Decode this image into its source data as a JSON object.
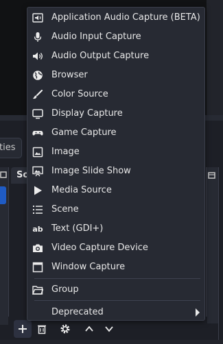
{
  "properties_button": {
    "label": "ties"
  },
  "sources_dock": {
    "title": "Sou"
  },
  "menu": {
    "items": [
      {
        "label": "Application Audio Capture (BETA)",
        "icon": "app-audio-icon"
      },
      {
        "label": "Audio Input Capture",
        "icon": "microphone-icon"
      },
      {
        "label": "Audio Output Capture",
        "icon": "speaker-icon"
      },
      {
        "label": "Browser",
        "icon": "globe-icon"
      },
      {
        "label": "Color Source",
        "icon": "paintbrush-icon"
      },
      {
        "label": "Display Capture",
        "icon": "monitor-icon"
      },
      {
        "label": "Game Capture",
        "icon": "gamepad-icon"
      },
      {
        "label": "Image",
        "icon": "image-icon"
      },
      {
        "label": "Image Slide Show",
        "icon": "slideshow-icon"
      },
      {
        "label": "Media Source",
        "icon": "play-icon"
      },
      {
        "label": "Scene",
        "icon": "list-icon"
      },
      {
        "label": "Text (GDI+)",
        "icon": "text-icon",
        "glyph": "ab"
      },
      {
        "label": "Video Capture Device",
        "icon": "camera-icon"
      },
      {
        "label": "Window Capture",
        "icon": "window-icon"
      }
    ],
    "group": {
      "label": "Group",
      "icon": "folder-icon"
    },
    "deprecated": {
      "label": "Deprecated"
    }
  },
  "colors": {
    "menu_bg": "#272a33",
    "accent_selection": "#1f5bc4",
    "text": "#e8e8e8"
  }
}
